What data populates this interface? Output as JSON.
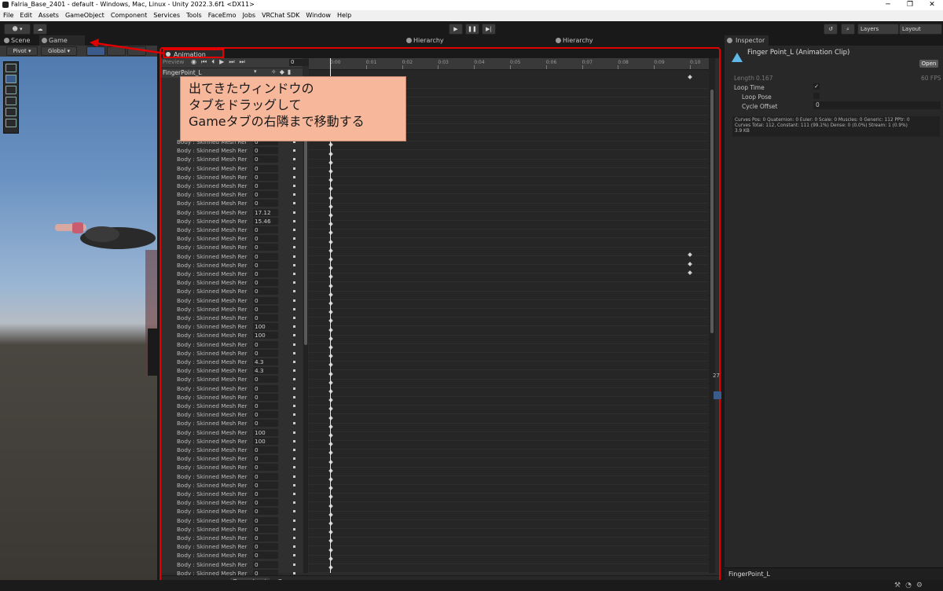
{
  "titlebar": {
    "title": "Falria_Base_2401 - default - Windows, Mac, Linux - Unity 2022.3.6f1 <DX11>",
    "min": "─",
    "max": "❐",
    "close": "✕"
  },
  "menu": [
    "File",
    "Edit",
    "Assets",
    "GameObject",
    "Component",
    "Services",
    "Tools",
    "FaceEmo",
    "Jobs",
    "VRChat SDK",
    "Window",
    "Help"
  ],
  "toolbar": {
    "account": "☻ ▾",
    "cloud": "☁",
    "play": "▶",
    "pause": "❚❚",
    "step": "▶|",
    "history": "↺",
    "search": "⌕",
    "layers": "Layers",
    "layout": "Layout"
  },
  "dock_left": {
    "scene": "Scene",
    "game": "Game"
  },
  "dock_mid": {
    "hierarchy1": "Hierarchy",
    "hierarchy2": "Hierarchy"
  },
  "scene_toolbar": {
    "pivot": "Pivot ▾",
    "global": "Global ▾"
  },
  "animation": {
    "tab": "Animation",
    "preview": "Preview",
    "frame": "0",
    "clip": "FingerPoint_L",
    "row_label": "Body : Skinned Mesh Rer",
    "values": [
      "0",
      "0",
      "0",
      "0",
      "0",
      "0",
      "0",
      "0",
      "17.12",
      "15.46",
      "0",
      "0",
      "0",
      "0",
      "0",
      "0",
      "0",
      "0",
      "0",
      "0",
      "0",
      "100",
      "100",
      "0",
      "0",
      "4.3",
      "4.3",
      "0",
      "0",
      "0",
      "0",
      "0",
      "0",
      "100",
      "100",
      "0",
      "0",
      "0",
      "0",
      "0",
      "0",
      "0",
      "0",
      "0",
      "0",
      "0",
      "0",
      "0",
      "0",
      "0"
    ],
    "ruler": [
      "0:00",
      "0:01",
      "0:02",
      "0:03",
      "0:04",
      "0:05",
      "0:06",
      "0:07",
      "0:08",
      "0:09",
      "0:10"
    ],
    "dopesheet": "Dopesheet",
    "curves": "Curves"
  },
  "callout": {
    "line1": "出てきたウィンドウの",
    "line2": "タブをドラッグして",
    "line3": "Gameタブの右隣まで移動する"
  },
  "inspector": {
    "tab": "Inspector",
    "title": "Finger Point_L (Animation Clip)",
    "open": "Open",
    "length_label": "Length",
    "length_value": "0.167",
    "fps": "60 FPS",
    "loop_time": "Loop Time",
    "loop_pose": "Loop Pose",
    "cycle_offset": "Cycle Offset",
    "cycle_value": "0",
    "info1": "Curves Pos: 0 Quaternion: 0 Euler: 0 Scale: 0 Muscles: 0 Generic: 112 PPtr: 0",
    "info2": "Curves Total: 112, Constant: 111 (99.1%) Dense: 0 (0.0%) Stream: 1 (0.9%)",
    "info3": "3.9 KB",
    "footer": "FingerPoint_L",
    "side_number": "27"
  },
  "colors": {
    "highlight": "#e00000",
    "callout_bg": "#f7b79b",
    "key_blue": "#5b8fc8"
  }
}
